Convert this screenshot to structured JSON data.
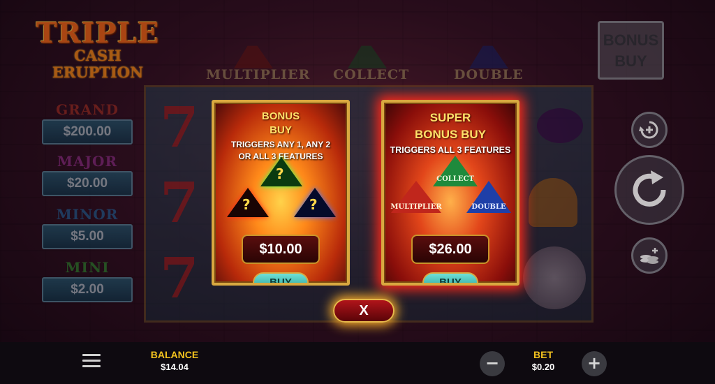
{
  "logo": {
    "line1": "TRIPLE",
    "line2": "CASH ERUPTION"
  },
  "features": [
    {
      "label": "MULTIPLIER",
      "color": "#c0261c"
    },
    {
      "label": "COLLECT",
      "color": "#1e8a3c"
    },
    {
      "label": "DOUBLE",
      "color": "#1e3fa8"
    }
  ],
  "jackpots": [
    {
      "name": "GRAND",
      "value": "$200.00",
      "color": "#c83a2a"
    },
    {
      "name": "MAJOR",
      "value": "$20.00",
      "color": "#b23aa8"
    },
    {
      "name": "MINOR",
      "value": "$5.00",
      "color": "#2a7ab8"
    },
    {
      "name": "MINI",
      "value": "$2.00",
      "color": "#3aa83a"
    }
  ],
  "bonus_buy_button": {
    "label": "BONUS BUY"
  },
  "offers": [
    {
      "title": "BONUS BUY",
      "description": "TRIGGERS ANY 1, ANY 2 OR ALL 3 FEATURES",
      "volcano_marks": [
        "?",
        "?",
        "?"
      ],
      "price": "$10.00",
      "buy_label": "BUY"
    },
    {
      "title": "SUPER BONUS BUY",
      "description": "TRIGGERS ALL 3 FEATURES",
      "volcano_labels": [
        "COLLECT",
        "MULTIPLIER",
        "DOUBLE"
      ],
      "price": "$26.00",
      "buy_label": "BUY"
    }
  ],
  "close_label": "X",
  "bottom": {
    "balance_label": "BALANCE",
    "balance_value": "$14.04",
    "bet_label": "BET",
    "bet_value": "$0.20",
    "minus": "−",
    "plus": "+"
  },
  "icons": [
    "menu-icon",
    "autoplay-icon",
    "spin-icon",
    "coins-icon"
  ]
}
